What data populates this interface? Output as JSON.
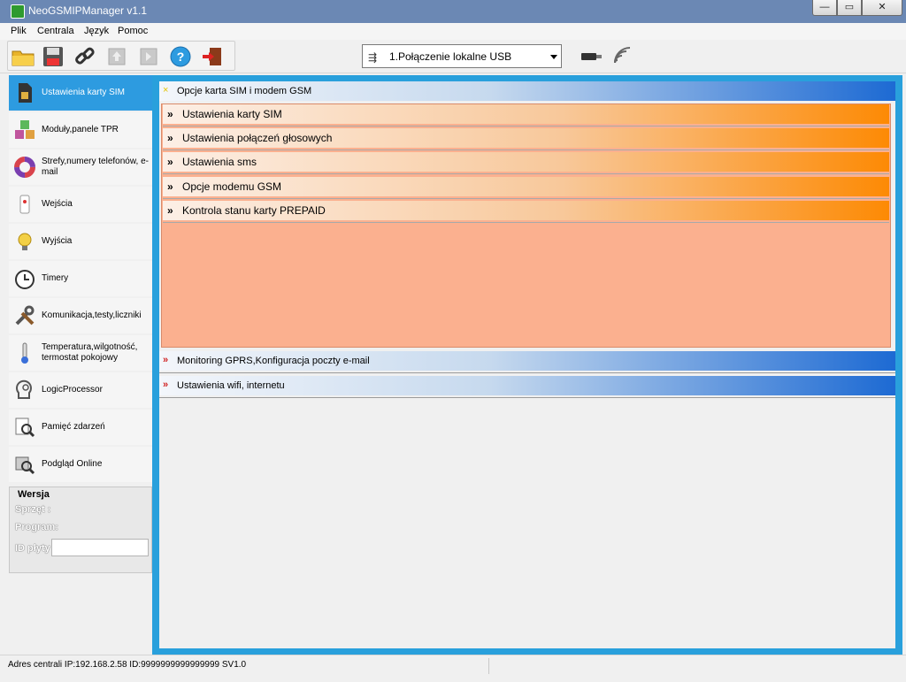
{
  "window": {
    "title": "NeoGSMIPManager v1.1",
    "controls": {
      "minimize": "—",
      "maximize": "▭",
      "close": "✕"
    }
  },
  "menu": [
    "Plik",
    "Centrala",
    "Język",
    "Pomoc"
  ],
  "toolbar": {
    "buttons": [
      {
        "name": "open-folder-icon"
      },
      {
        "name": "save-icon"
      },
      {
        "name": "link-icon"
      },
      {
        "name": "upload-chip-icon",
        "disabled": true
      },
      {
        "name": "download-chip-icon",
        "disabled": true
      },
      {
        "name": "help-icon"
      },
      {
        "name": "exit-icon"
      }
    ],
    "connection": {
      "selected": "1.Połączenie lokalne USB",
      "usb_glyph": "⇶"
    },
    "status_icons": [
      "usb-stick-icon",
      "wireless-signal-icon"
    ]
  },
  "sidebar": {
    "items": [
      {
        "label": "Ustawienia karty SIM",
        "icon": "sim-card-icon",
        "active": true
      },
      {
        "label": "Moduły,panele TPR",
        "icon": "modules-cubes-icon"
      },
      {
        "label": "Strefy,numery telefonów, e-mail",
        "icon": "zones-ring-icon"
      },
      {
        "label": "Wejścia",
        "icon": "sensor-icon"
      },
      {
        "label": "Wyjścia",
        "icon": "lightbulb-icon"
      },
      {
        "label": "Timery",
        "icon": "alarm-clock-icon"
      },
      {
        "label": "Komunikacja,testy,liczniki",
        "icon": "tools-icon"
      },
      {
        "label": "Temperatura,wilgotność, termostat pokojowy",
        "icon": "thermometer-icon"
      },
      {
        "label": "LogicProcessor",
        "icon": "logic-head-icon"
      },
      {
        "label": "Pamięć zdarzeń",
        "icon": "event-memory-icon"
      },
      {
        "label": "Podgląd Online",
        "icon": "online-preview-icon"
      }
    ]
  },
  "version": {
    "legend": "Wersja",
    "hardware_label": "Sprzęt :",
    "program_label": "Program:",
    "board_id_label": "ID płyty",
    "board_id_value": ""
  },
  "main": {
    "sections": [
      {
        "label": "Opcje karta SIM i modem GSM",
        "mark": "×",
        "expanded": true,
        "items": [
          "Ustawienia karty SIM",
          "Ustawienia połączeń głosowych",
          "Ustawienia sms",
          "Opcje modemu GSM",
          "Kontrola stanu karty PREPAID"
        ]
      },
      {
        "label": "Monitoring GPRS,Konfiguracja poczty e-mail",
        "mark": "»",
        "expanded": false
      },
      {
        "label": "Ustawienia wifi, internetu",
        "mark": "»",
        "expanded": false
      }
    ],
    "item_mark": "»"
  },
  "statusbar": {
    "text": "Adres centrali IP:192.168.2.58 ID:9999999999999999 SV1.0"
  },
  "colors": {
    "accent_blue": "#29a0dc",
    "header_dark_blue": "#1d6ad3",
    "orange": "#fd8a04",
    "salmon": "#fbb08f"
  }
}
